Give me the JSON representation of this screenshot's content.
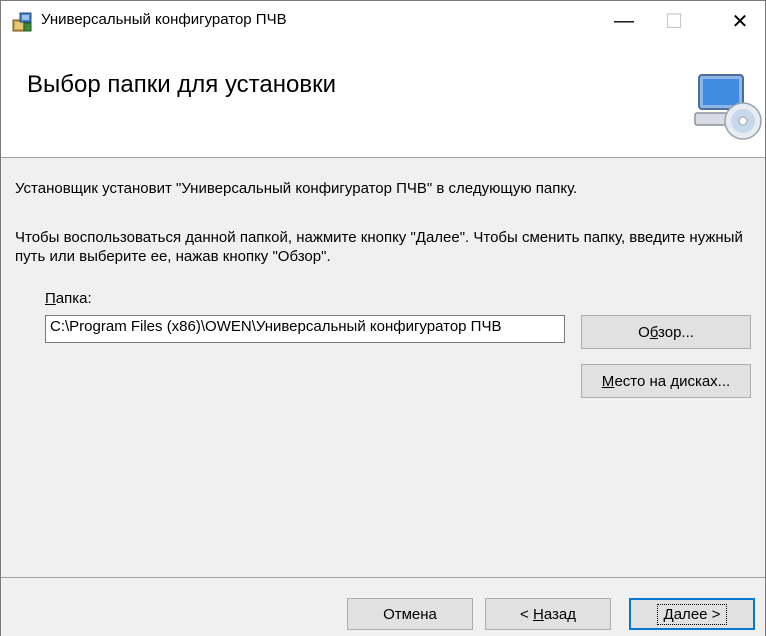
{
  "window": {
    "title": "Универсальный конфигуратор ПЧВ",
    "minimize_glyph": "—",
    "maximize_glyph": "☐",
    "close_glyph": "✕"
  },
  "header": {
    "title": "Выбор папки для установки",
    "graphic_icon": "computer-cd-icon"
  },
  "content": {
    "line1": "Установщик установит \"Универсальный конфигуратор ПЧВ\" в следующую папку.",
    "line2": "Чтобы воспользоваться данной папкой, нажмите кнопку \"Далее\". Чтобы сменить папку, введите нужный путь или выберите ее, нажав кнопку \"Обзор\".",
    "folder_label_mnemonic": "П",
    "folder_label_rest": "апка:",
    "path_value": "C:\\Program Files (x86)\\OWEN\\Универсальный конфигуратор ПЧВ",
    "browse_pre": "О",
    "browse_mnemonic": "б",
    "browse_post": "зор...",
    "disk_mnemonic": "М",
    "disk_rest": "есто на дисках..."
  },
  "footer": {
    "cancel_label": "Отмена",
    "back_pre": "< ",
    "back_mnemonic": "Н",
    "back_rest": "азад",
    "next_mnemonic": "Д",
    "next_rest": "алее >"
  },
  "colors": {
    "window_bg": "#f0f0f0",
    "header_bg": "#ffffff",
    "focus_border": "#0078d7",
    "button_bg": "#e1e1e1"
  }
}
